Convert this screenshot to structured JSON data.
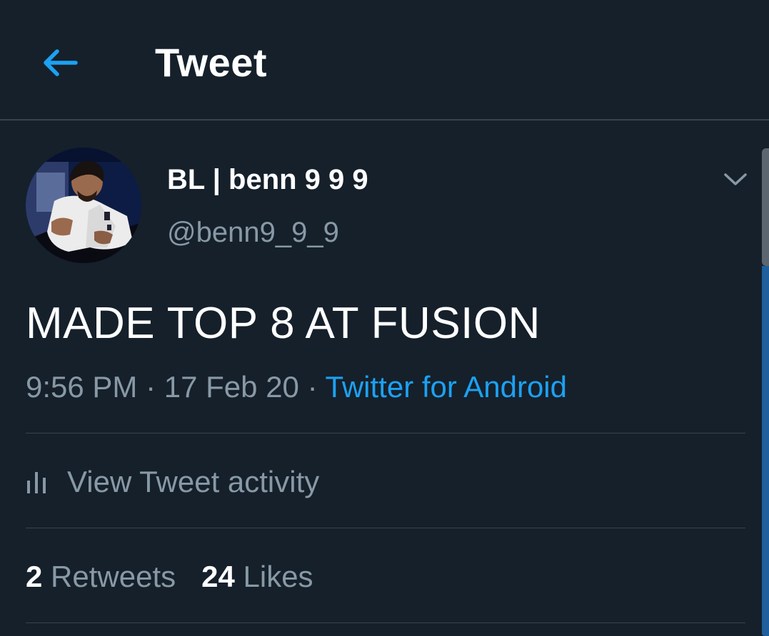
{
  "header": {
    "title": "Tweet",
    "back_icon": "arrow-left-icon",
    "accent": "#1da1f2"
  },
  "tweet": {
    "author": {
      "display_name": "BL | benn 9 9 9",
      "handle": "@benn9_9_9"
    },
    "text": "MADE TOP 8 AT FUSION",
    "time": "9:56 PM",
    "separator": "·",
    "date": "17 Feb 20",
    "source": "Twitter for Android"
  },
  "activity": {
    "icon": "bar-chart-icon",
    "label": "View Tweet activity"
  },
  "stats": {
    "retweets_count": "2",
    "retweets_label": "Retweets",
    "likes_count": "24",
    "likes_label": "Likes"
  },
  "colors": {
    "background": "#15202b",
    "divider": "#38444d",
    "secondary_text": "#8899a6",
    "primary_text": "#ffffff"
  }
}
